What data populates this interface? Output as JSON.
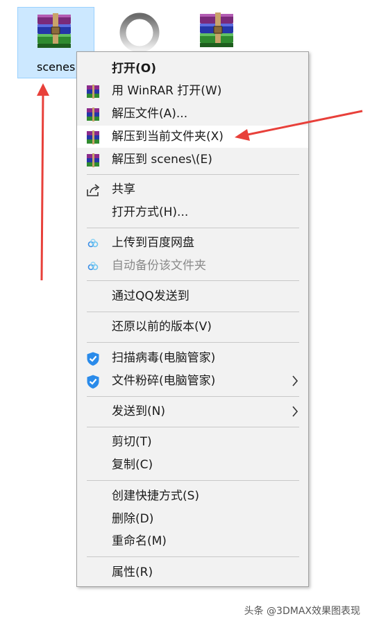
{
  "desktop": {
    "files": [
      {
        "label": "scenes",
        "type": "rar-archive",
        "selected": true
      },
      {
        "label": "",
        "type": "loading-icon",
        "selected": false
      },
      {
        "label": "",
        "type": "rar-archive",
        "selected": false
      }
    ]
  },
  "context_menu": {
    "items": [
      {
        "label": "打开(O)",
        "icon": "",
        "bold": true,
        "disabled": false,
        "highlighted": false,
        "submenu": false
      },
      {
        "label": "用 WinRAR 打开(W)",
        "icon": "winrar-icon",
        "bold": false,
        "disabled": false,
        "highlighted": false,
        "submenu": false
      },
      {
        "label": "解压文件(A)...",
        "icon": "winrar-icon",
        "bold": false,
        "disabled": false,
        "highlighted": false,
        "submenu": false
      },
      {
        "label": "解压到当前文件夹(X)",
        "icon": "winrar-icon",
        "bold": false,
        "disabled": false,
        "highlighted": true,
        "submenu": false
      },
      {
        "label": "解压到 scenes\\(E)",
        "icon": "winrar-icon",
        "bold": false,
        "disabled": false,
        "highlighted": false,
        "submenu": false
      },
      {
        "label": "共享",
        "icon": "share-icon",
        "bold": false,
        "disabled": false,
        "highlighted": false,
        "submenu": false
      },
      {
        "label": "打开方式(H)...",
        "icon": "",
        "bold": false,
        "disabled": false,
        "highlighted": false,
        "submenu": false
      },
      {
        "label": "上传到百度网盘",
        "icon": "baidu-cloud-icon",
        "bold": false,
        "disabled": false,
        "highlighted": false,
        "submenu": false
      },
      {
        "label": "自动备份该文件夹",
        "icon": "baidu-cloud-icon",
        "bold": false,
        "disabled": true,
        "highlighted": false,
        "submenu": false
      },
      {
        "label": "通过QQ发送到",
        "icon": "",
        "bold": false,
        "disabled": false,
        "highlighted": false,
        "submenu": false
      },
      {
        "label": "还原以前的版本(V)",
        "icon": "",
        "bold": false,
        "disabled": false,
        "highlighted": false,
        "submenu": false
      },
      {
        "label": "扫描病毒(电脑管家)",
        "icon": "shield-icon",
        "bold": false,
        "disabled": false,
        "highlighted": false,
        "submenu": false
      },
      {
        "label": "文件粉碎(电脑管家)",
        "icon": "shield-icon",
        "bold": false,
        "disabled": false,
        "highlighted": false,
        "submenu": true
      },
      {
        "label": "发送到(N)",
        "icon": "",
        "bold": false,
        "disabled": false,
        "highlighted": false,
        "submenu": true
      },
      {
        "label": "剪切(T)",
        "icon": "",
        "bold": false,
        "disabled": false,
        "highlighted": false,
        "submenu": false
      },
      {
        "label": "复制(C)",
        "icon": "",
        "bold": false,
        "disabled": false,
        "highlighted": false,
        "submenu": false
      },
      {
        "label": "创建快捷方式(S)",
        "icon": "",
        "bold": false,
        "disabled": false,
        "highlighted": false,
        "submenu": false
      },
      {
        "label": "删除(D)",
        "icon": "",
        "bold": false,
        "disabled": false,
        "highlighted": false,
        "submenu": false
      },
      {
        "label": "重命名(M)",
        "icon": "",
        "bold": false,
        "disabled": false,
        "highlighted": false,
        "submenu": false
      },
      {
        "label": "属性(R)",
        "icon": "",
        "bold": false,
        "disabled": false,
        "highlighted": false,
        "submenu": false
      }
    ]
  },
  "annotations": {
    "arrow_color": "#e8403a"
  },
  "watermark": "头条 @3DMAX效果图表现"
}
